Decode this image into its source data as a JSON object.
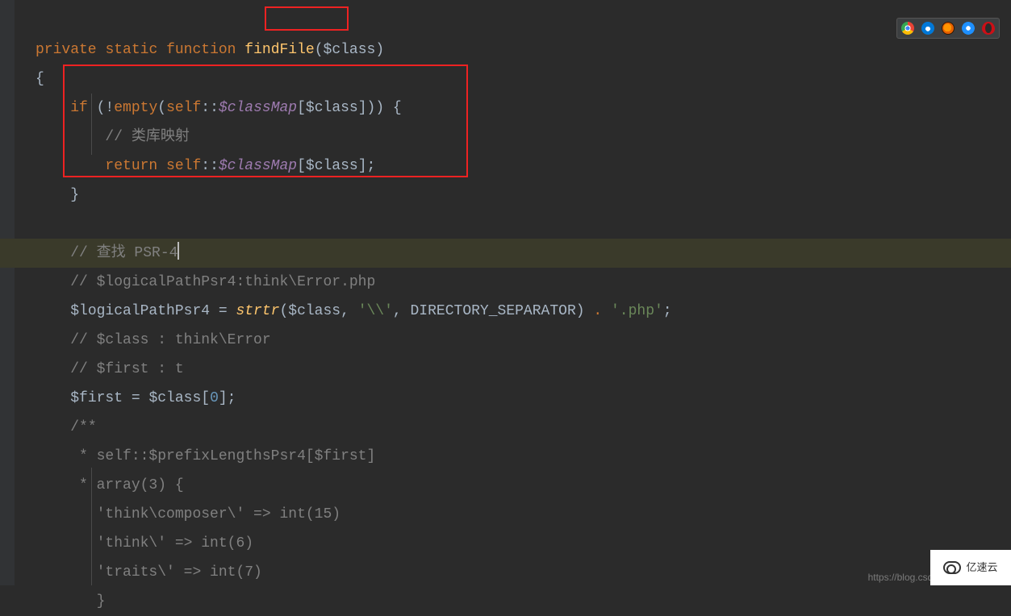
{
  "code": {
    "line1": {
      "kw1": "private",
      "kw2": "static",
      "kw3": "function",
      "fn": "findFile",
      "params": "($class)"
    },
    "line2": {
      "brace": "{"
    },
    "line3": {
      "kw_if": "if",
      "open": " (!",
      "empty": "empty",
      "p1": "(",
      "self": "self",
      "dcolon": "::",
      "cm": "$classMap",
      "idx": "[$class])) {"
    },
    "line4": {
      "cmt": "// 类库映射"
    },
    "line5": {
      "ret": "return",
      "sp": " ",
      "self": "self",
      "dcolon": "::",
      "cm": "$classMap",
      "idx": "[$class];"
    },
    "line6": {
      "brace": "}"
    },
    "line8": {
      "cmt": "// 查找 PSR-4"
    },
    "line9": {
      "cmt": "// $logicalPathPsr4:think\\Error.php"
    },
    "line10": {
      "lhs": "$logicalPathPsr4",
      "eq": " = ",
      "fn": "strtr",
      "args_open": "($class, ",
      "s1": "'\\\\'",
      "comma": ", DIRECTORY_SEPARATOR) ",
      "dot": ".",
      "sp": " ",
      "s2": "'.php'",
      "semi": ";"
    },
    "line11": {
      "cmt": "// $class : think\\Error"
    },
    "line12": {
      "cmt": "// $first : t"
    },
    "line13": {
      "lhs": "$first",
      "eq": " = ",
      "rhs1": "$class[",
      "num": "0",
      "rhs2": "];"
    },
    "line14": {
      "cmt": "/**"
    },
    "line15": {
      "cmt": " * self::$prefixLengthsPsr4[$first]"
    },
    "line16": {
      "cmt": " * array(3) {"
    },
    "line17": {
      "cmt": "   'think\\composer\\' => int(15)"
    },
    "line18": {
      "cmt": "   'think\\' => int(6)"
    },
    "line19": {
      "cmt": "   'traits\\' => int(7)"
    },
    "line20": {
      "cmt": "   }"
    }
  },
  "browsers": [
    "chrome",
    "edge",
    "firefox",
    "safari",
    "opera"
  ],
  "watermark_url": "https://blog.csdn.n",
  "yisu_label": "亿速云"
}
